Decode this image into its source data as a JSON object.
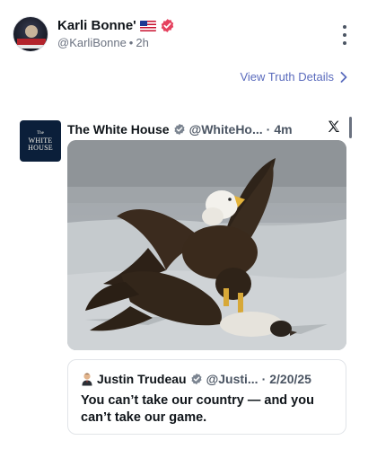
{
  "post": {
    "author_name": "Karli Bonne'",
    "handle": "@KarliBonne",
    "separator": "•",
    "time": "2h",
    "flag_icon": "us-flag-icon",
    "verified_color": "#e5425f"
  },
  "view_details": {
    "label": "View Truth Details"
  },
  "embed": {
    "avatar_text": [
      "The",
      "WHITE",
      "HOUSE"
    ],
    "author_name": "The White House",
    "handle": "@WhiteHo...",
    "separator": "·",
    "time": "4m",
    "platform_icon": "x-logo-icon",
    "image_description_icon": "bald-eagle-photo"
  },
  "quote": {
    "author_name": "Justin Trudeau",
    "handle": "@Justi...",
    "separator": "·",
    "date": "2/20/25",
    "text": "You can’t take our country — and you can’t take our game."
  },
  "colors": {
    "accent_link": "#5a6bbd",
    "verified_pink": "#e5425f",
    "verified_grey": "#7c8591"
  }
}
